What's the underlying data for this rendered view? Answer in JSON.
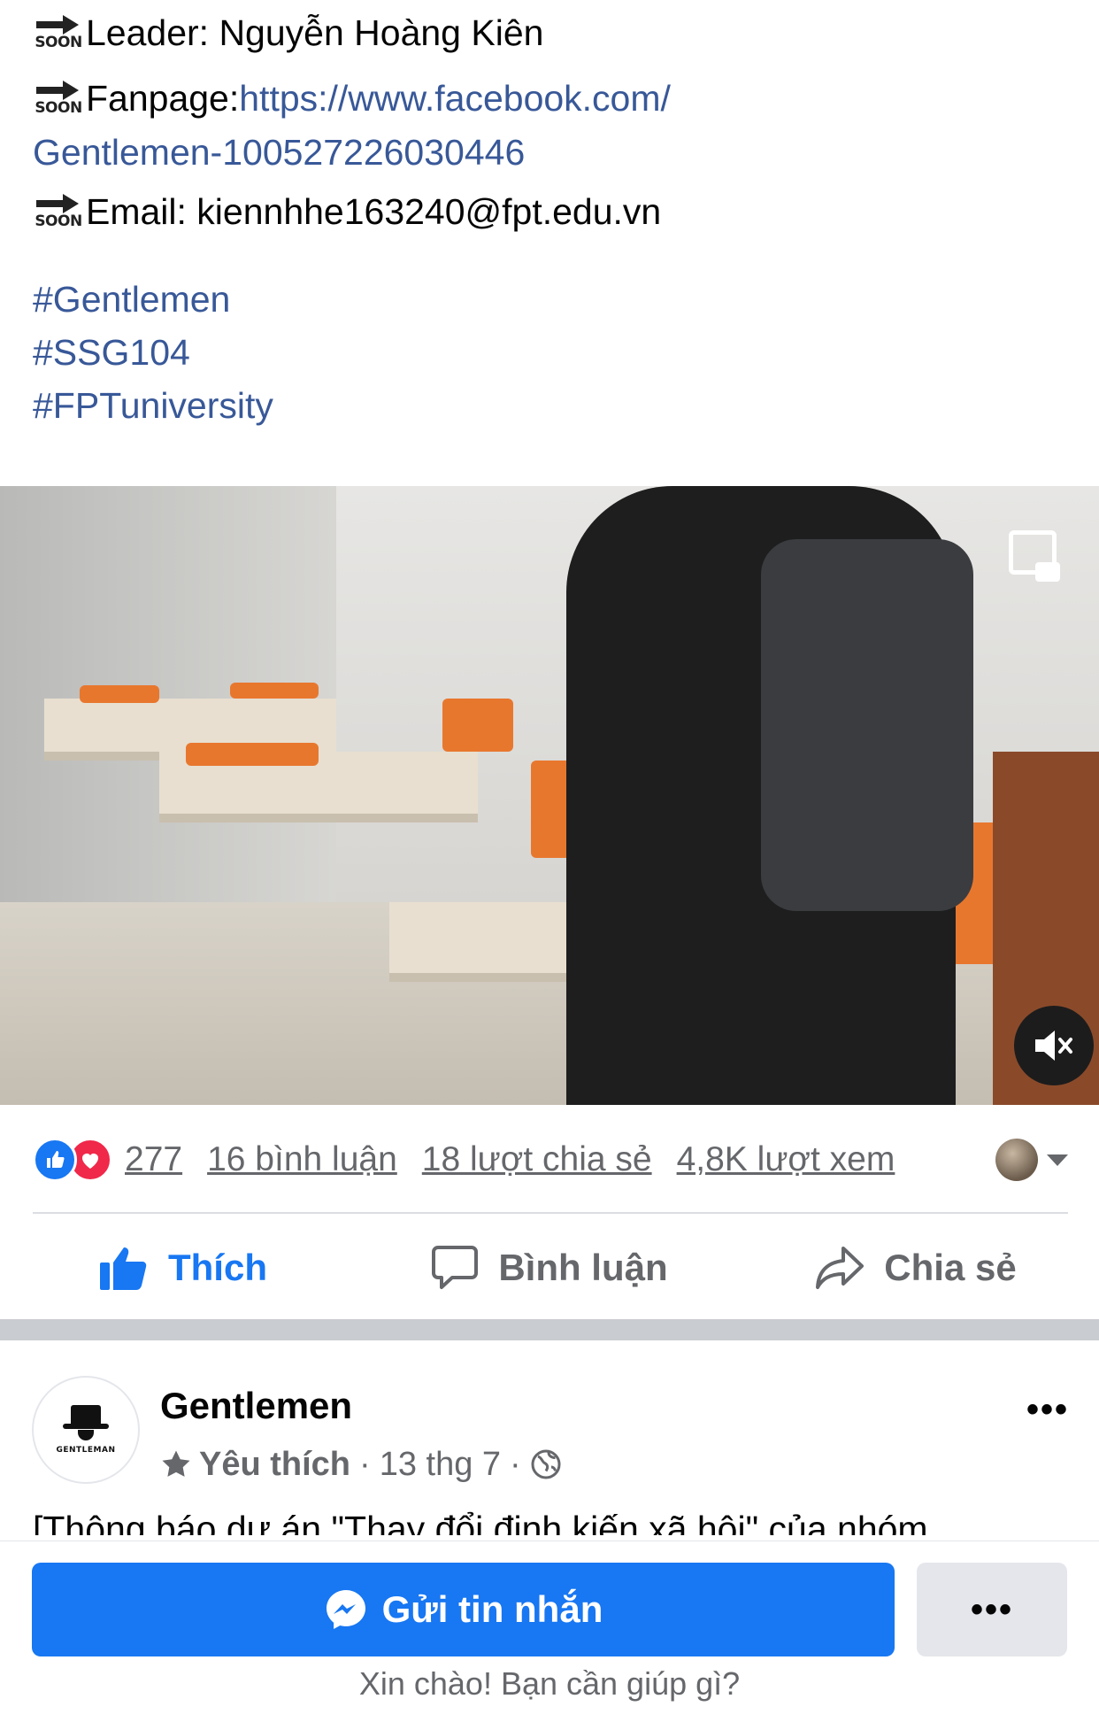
{
  "post": {
    "leader_label": "Leader: Nguyễn Hoàng Kiên",
    "fanpage_label": "Fanpage: ",
    "fanpage_url_1": "https://www.facebook.com/",
    "fanpage_url_2": "Gentlemen-100527226030446",
    "email_label": "Email: kiennhhe163240@fpt.edu.vn",
    "soon_text": "SOON",
    "hashtags": [
      "#Gentlemen",
      "#SSG104",
      "#FPTuniversity"
    ]
  },
  "video": {
    "pip_icon": "picture-in-picture-icon",
    "mute_icon": "speaker-muted-icon"
  },
  "stats": {
    "reaction_count": "277",
    "comments": "16 bình luận",
    "shares": "18 lượt chia sẻ",
    "views": "4,8K lượt xem"
  },
  "actions": {
    "like": "Thích",
    "comment": "Bình luận",
    "share": "Chia sẻ"
  },
  "next_post": {
    "page_name": "Gentlemen",
    "favorite_label": "Yêu thích",
    "date": "13 thg 7",
    "brand_text": "GENTLEMAN",
    "preview_text": "[Thông báo dự án \"Thay đổi định kiến xã hội\" của nhóm"
  },
  "bottom_bar": {
    "send_label": "Gửi tin nhắn",
    "more_label": "•••",
    "greeting": "Xin chào! Bạn cần giúp gì?"
  },
  "colors": {
    "link": "#385898",
    "facebook_blue": "#1877f2",
    "secondary_text": "#65676b",
    "love_red": "#f0284a"
  }
}
